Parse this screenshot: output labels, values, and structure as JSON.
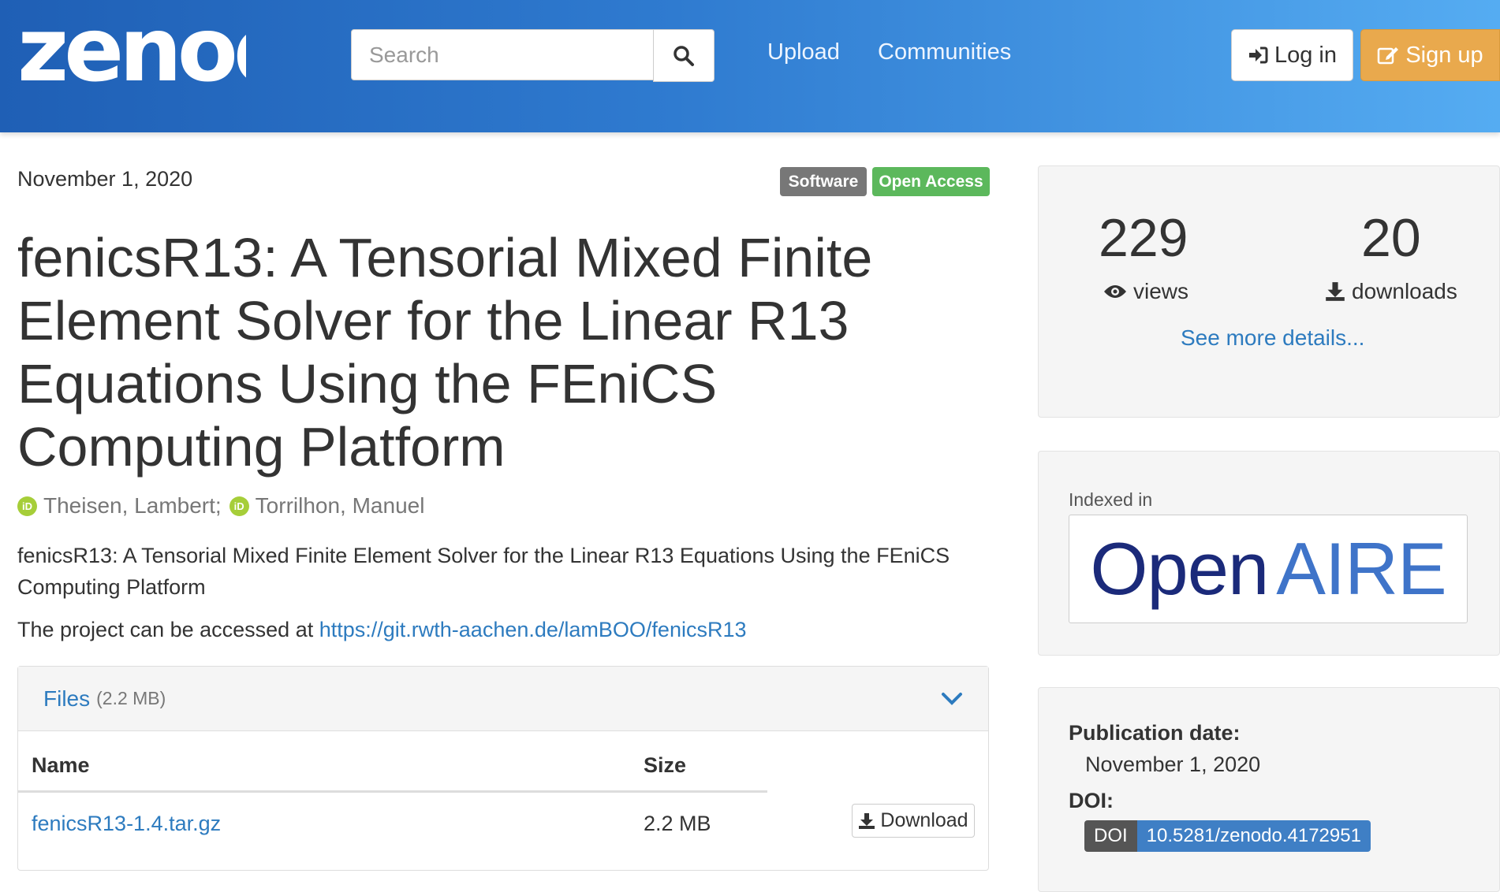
{
  "header": {
    "logo_text": "zenodo",
    "search": {
      "placeholder": "Search",
      "value": ""
    },
    "nav": {
      "upload": "Upload",
      "communities": "Communities"
    },
    "login_label": "Log in",
    "signup_label": "Sign up"
  },
  "record": {
    "date": "November 1, 2020",
    "type_badge": "Software",
    "access_badge": "Open Access",
    "title": "fenicsR13: A Tensorial Mixed Finite Element Solver for the Linear R13 Equations Using the FEniCS Computing Platform",
    "authors": [
      "Theisen, Lambert;",
      "Torrilhon, Manuel"
    ],
    "orcid_glyph": "iD",
    "description": "fenicsR13: A Tensorial Mixed Finite Element Solver for the Linear R13 Equations Using the FEniCS Computing Platform",
    "access_prefix": "The project can be accessed at ",
    "access_url": "https://git.rwth-aachen.de/lamBOO/fenicsR13"
  },
  "files": {
    "title": "Files",
    "total_size": "(2.2 MB)",
    "columns": {
      "name": "Name",
      "size": "Size"
    },
    "rows": [
      {
        "name": "fenicsR13-1.4.tar.gz",
        "size": "2.2 MB",
        "action": "Download"
      }
    ]
  },
  "stats": {
    "views": "229",
    "views_label": "views",
    "downloads": "20",
    "downloads_label": "downloads",
    "more_link": "See more details..."
  },
  "indexed": {
    "label": "Indexed in",
    "logo_part1": "Open",
    "logo_part2": "AIRE"
  },
  "publication": {
    "date_label": "Publication date:",
    "date_value": "November 1, 2020",
    "doi_label": "DOI:",
    "doi_tag": "DOI",
    "doi_value": "10.5281/zenodo.4172951"
  },
  "colors": {
    "header_gradient": [
      "#1f5fb5",
      "#55acf2"
    ],
    "link": "#2d7bbf",
    "signup": "#e9a94d",
    "open_access": "#5cb85c",
    "orcid": "#a6ce39"
  }
}
